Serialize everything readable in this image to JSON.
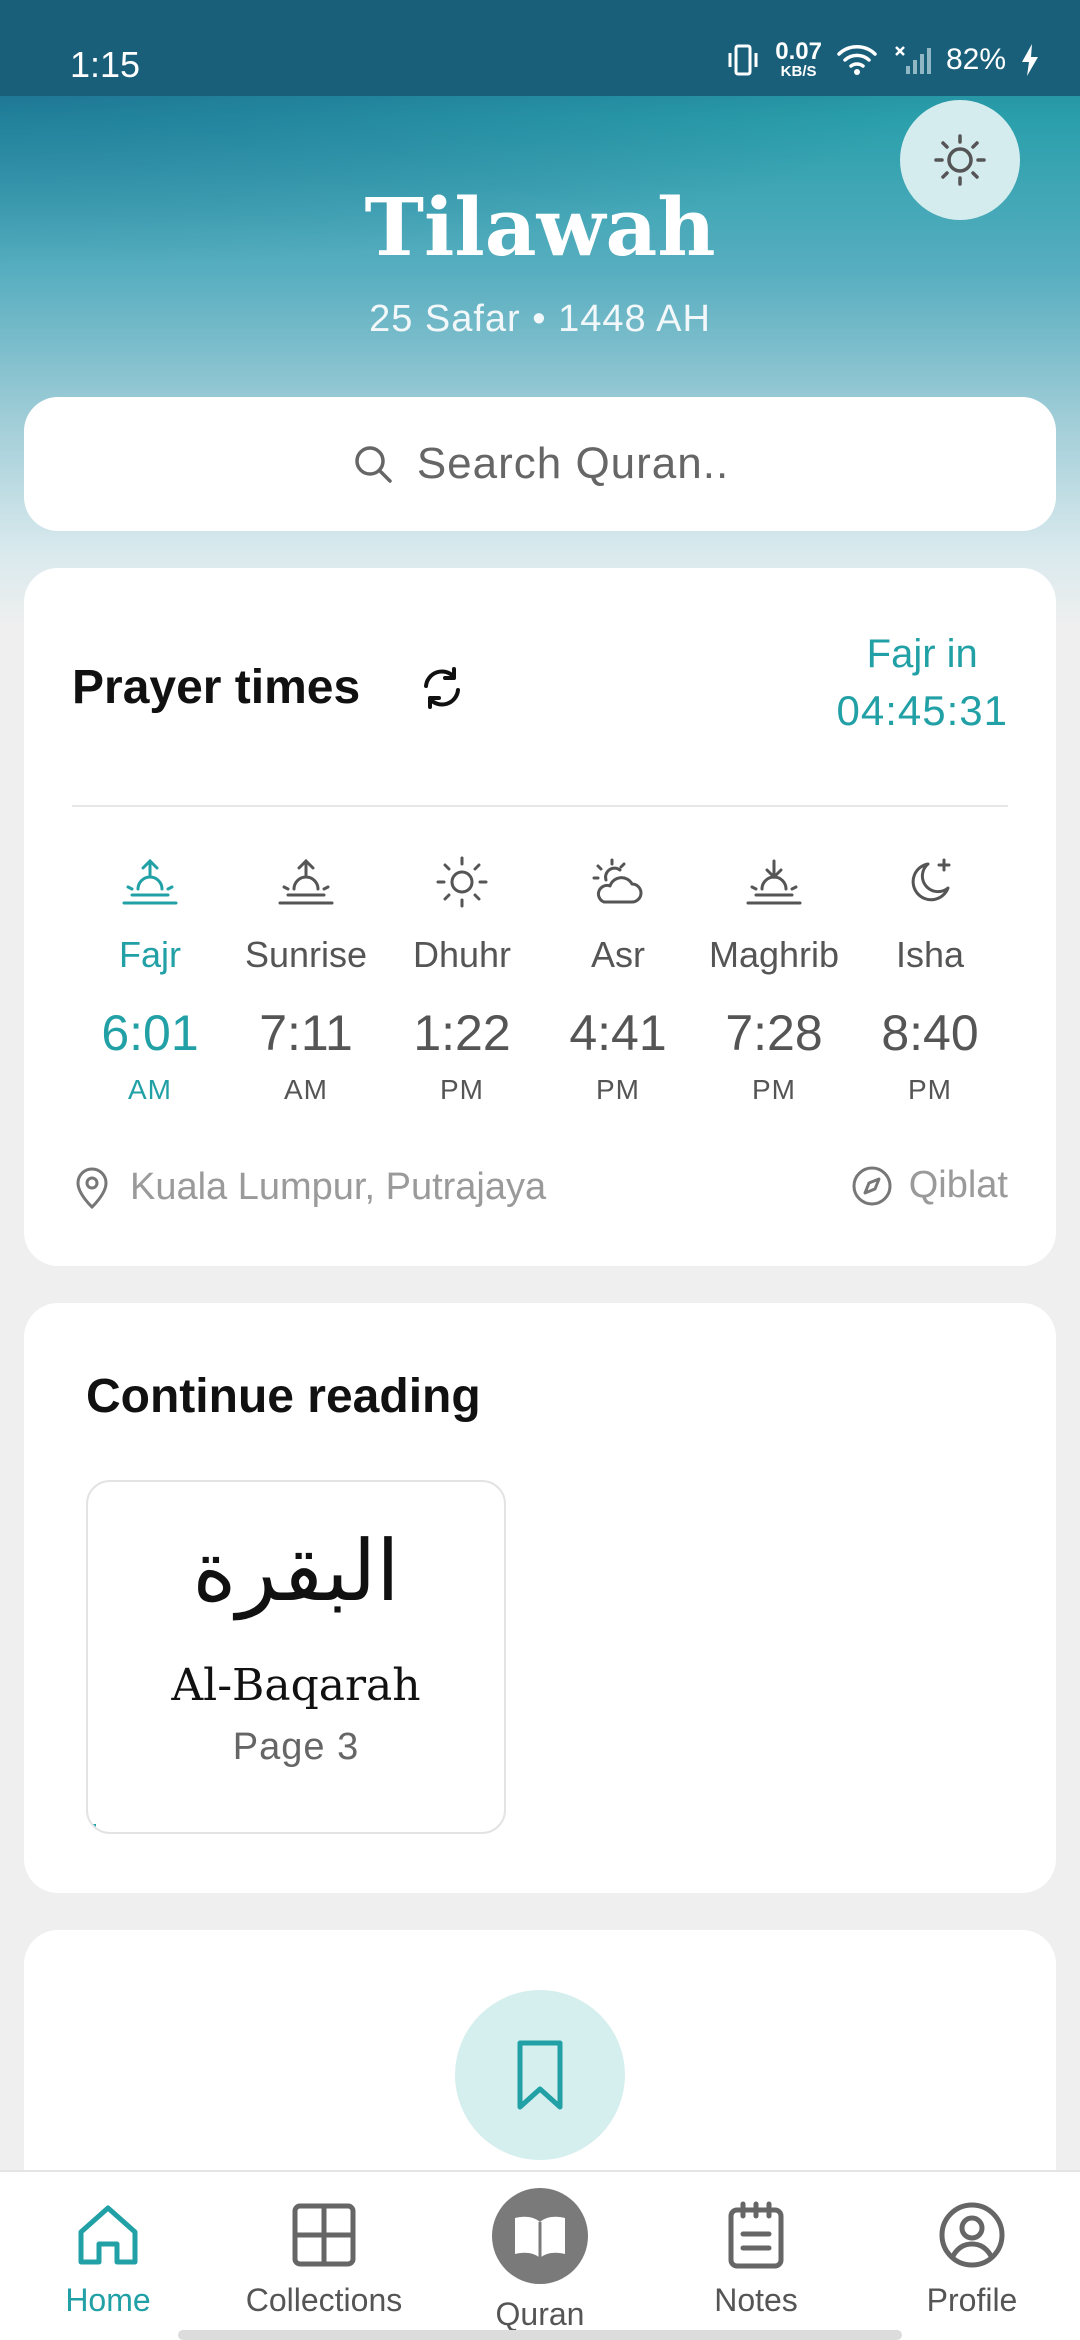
{
  "status_bar": {
    "time": "1:15",
    "net_speed_value": "0.07",
    "net_speed_unit": "KB/S",
    "battery": "82%"
  },
  "header": {
    "title": "Tilawah",
    "hijri_date": "25 Safar • 1448 AH",
    "theme_icon": "sun-icon"
  },
  "search": {
    "placeholder": "Search Quran.."
  },
  "prayer": {
    "title": "Prayer times",
    "next_label": "Fajr in",
    "next_countdown": "04:45:31",
    "times": [
      {
        "name": "Fajr",
        "time": "6:01",
        "ampm": "AM",
        "icon": "sunrise-up-icon",
        "active": true
      },
      {
        "name": "Sunrise",
        "time": "7:11",
        "ampm": "AM",
        "icon": "sunrise-up-icon",
        "active": false
      },
      {
        "name": "Dhuhr",
        "time": "1:22",
        "ampm": "PM",
        "icon": "sun-icon",
        "active": false
      },
      {
        "name": "Asr",
        "time": "4:41",
        "ampm": "PM",
        "icon": "sun-cloud-icon",
        "active": false
      },
      {
        "name": "Maghrib",
        "time": "7:28",
        "ampm": "PM",
        "icon": "sunset-down-icon",
        "active": false
      },
      {
        "name": "Isha",
        "time": "8:40",
        "ampm": "PM",
        "icon": "moon-star-icon",
        "active": false
      }
    ],
    "location": "Kuala Lumpur, Putrajaya",
    "qiblat_label": "Qiblat"
  },
  "continue_reading": {
    "title": "Continue reading",
    "surah_arabic": "البقرة",
    "surah_name": "Al-Baqarah",
    "page": "Page 3",
    "progress_fraction": 0.02
  },
  "nav": {
    "items": [
      {
        "label": "Home",
        "icon": "home-icon",
        "active": true
      },
      {
        "label": "Collections",
        "icon": "grid-icon",
        "active": false
      },
      {
        "label": "Quran",
        "icon": "book-open-icon",
        "active": false
      },
      {
        "label": "Notes",
        "icon": "notepad-icon",
        "active": false
      },
      {
        "label": "Profile",
        "icon": "user-circle-icon",
        "active": false
      }
    ]
  },
  "colors": {
    "accent": "#21a0a6",
    "header_top": "#1a5f7a",
    "fab_bg": "#d4efee"
  }
}
